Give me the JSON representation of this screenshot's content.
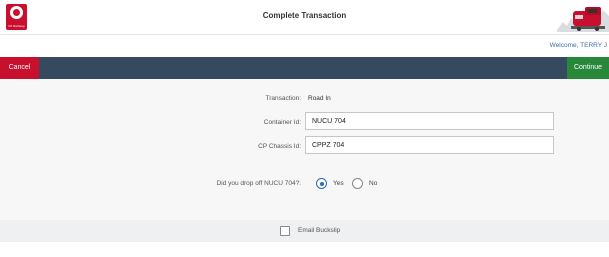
{
  "header": {
    "logo_text": "CP Railway",
    "title": "Complete Transaction"
  },
  "welcome": "Welcome, TERRY J",
  "actions": {
    "cancel_label": "Cancel",
    "continue_label": "Continue"
  },
  "form": {
    "transaction_label": "Transaction:",
    "transaction_value": "Road In",
    "container_label": "Container Id:",
    "container_value": "NUCU 704",
    "chassis_label": "CP Chassis Id:",
    "chassis_value": "CPPZ 704",
    "dropoff_question": "Did you drop off NUCU 704?:",
    "options": [
      {
        "label": "Yes",
        "selected": true
      },
      {
        "label": "No",
        "selected": false
      }
    ]
  },
  "email": {
    "label": "Email Buckslip",
    "checked": false
  },
  "colors": {
    "brand_red": "#c8102e",
    "action_bar": "#354a5f",
    "continue_green": "#27883a",
    "link_blue": "#3b6fa8"
  }
}
